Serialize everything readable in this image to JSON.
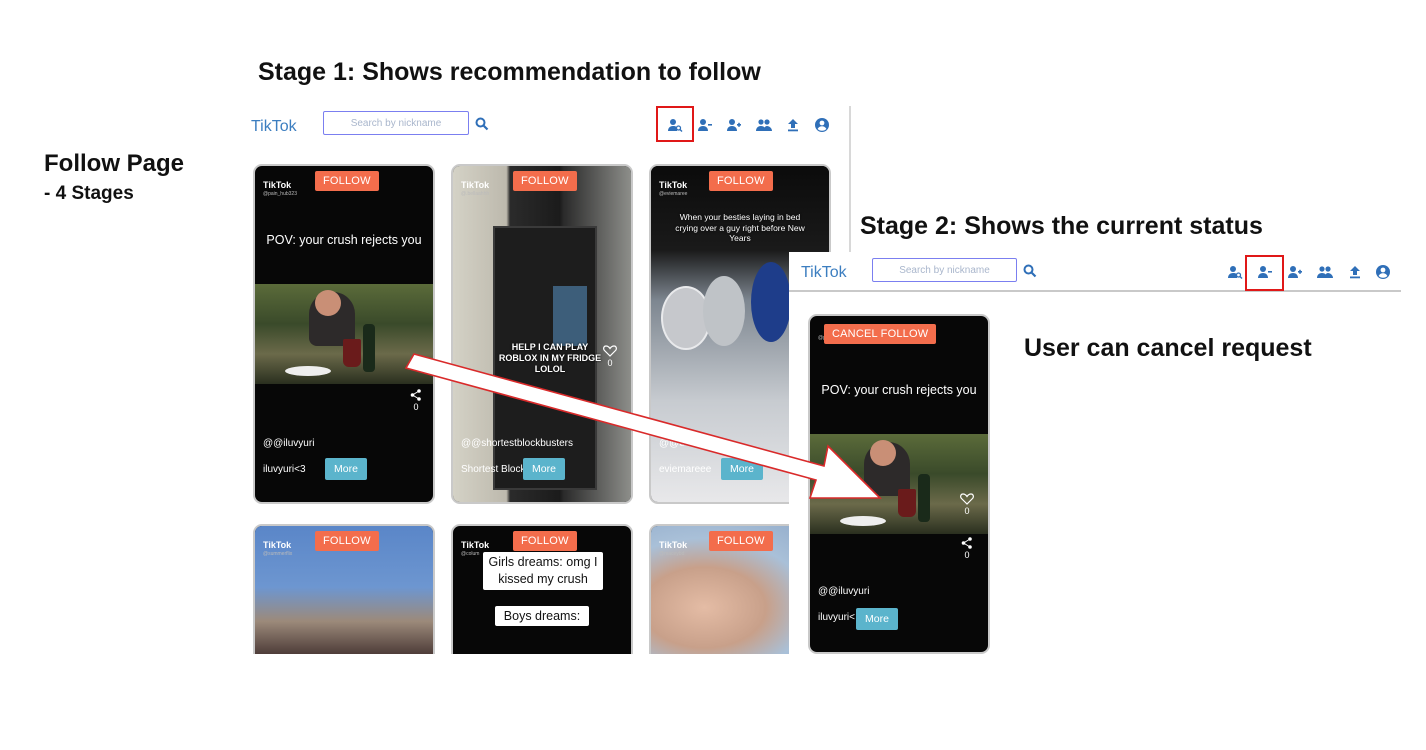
{
  "slide": {
    "stage1_heading": "Stage 1: Shows recommendation to follow",
    "stage2_heading": "Stage 2: Shows the current status",
    "page_title": "Follow Page",
    "page_subtitle": "- 4 Stages",
    "cancel_note": "User can cancel request"
  },
  "app": {
    "brand": "TikTok",
    "search_placeholder": "Search by nickname",
    "nav_icons": [
      "recommend-icon",
      "following-icon",
      "add-follow-icon",
      "friends-icon",
      "upload-icon",
      "account-icon"
    ]
  },
  "stage1": {
    "highlighted_nav": "recommend-icon",
    "cards": [
      {
        "follow_label": "FOLLOW",
        "tiktok_label": "TikTok",
        "caption": "POV: your crush rejects you",
        "likes": "",
        "shares": "0",
        "author": "@@iluvyuri",
        "desc": "iluvyuri<3",
        "more_label": "More"
      },
      {
        "follow_label": "FOLLOW",
        "tiktok_label": "TikTok",
        "caption": "HELP I CAN PLAY ROBLOX IN MY FRIDGE LOLOL",
        "likes": "0",
        "shares": "",
        "author": "@@shortestblockbusters",
        "desc": "Shortest Block",
        "more_label": "More"
      },
      {
        "follow_label": "FOLLOW",
        "tiktok_label": "TikTok",
        "caption": "When your besties laying in bed crying over a guy right before New Years",
        "likes": "",
        "shares": "",
        "author": "@@e",
        "desc": "eviemareee",
        "more_label": "More"
      },
      {
        "follow_label": "FOLLOW",
        "tiktok_label": "TikTok",
        "caption": "",
        "author": "",
        "desc": ""
      },
      {
        "follow_label": "FOLLOW",
        "tiktok_label": "TikTok",
        "caption": "Girls dreams: omg I kissed my crush",
        "caption2": "Boys dreams:",
        "author": "",
        "desc": ""
      },
      {
        "follow_label": "FOLLOW",
        "tiktok_label": "TikTok",
        "caption": "",
        "author": "",
        "desc": ""
      }
    ]
  },
  "stage2": {
    "highlighted_nav": "following-icon",
    "card": {
      "follow_label": "CANCEL FOLLOW",
      "caption": "POV: your crush rejects you",
      "likes": "0",
      "shares": "0",
      "author": "@@iluvyuri",
      "desc": "iluvyuri<",
      "more_label": "More"
    }
  },
  "colors": {
    "follow": "#f36d4c",
    "more": "#5bb4cc",
    "brand": "#3c7ec0",
    "highlight": "#e01818"
  }
}
